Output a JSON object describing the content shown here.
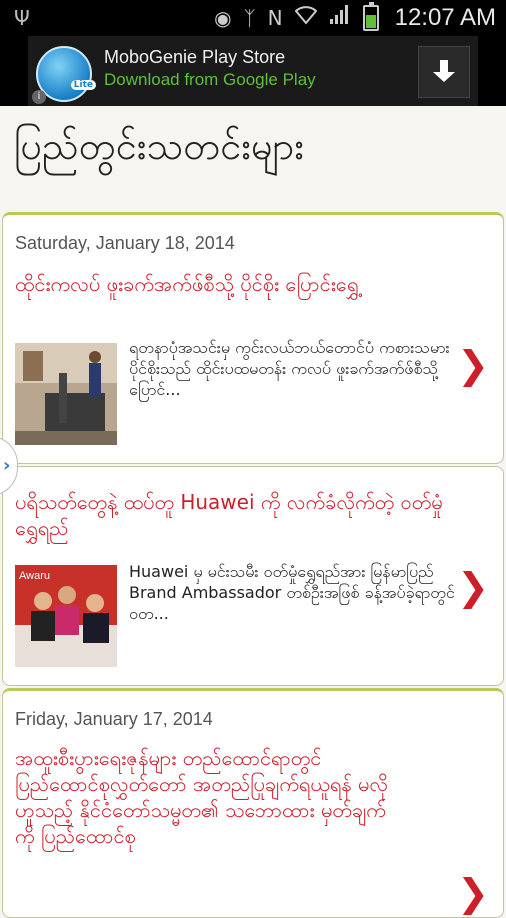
{
  "status_bar": {
    "time": "12:07 AM",
    "icons": [
      "usb-icon",
      "eye-icon",
      "bluetooth-icon",
      "nfc-icon",
      "wifi-icon",
      "signal-icon",
      "battery-icon"
    ]
  },
  "ad": {
    "logo_badge": "Lite",
    "title": "MoboGenie Play Store",
    "subtitle": "Download from Google Play",
    "info": "i",
    "colors": {
      "subtitle": "#5fbf3a",
      "background": "#1a1a1a"
    }
  },
  "header": {
    "title": "ပြည်တွင်းသတင်းများ"
  },
  "feed": {
    "accent_color": "#cc1f2a",
    "sections": [
      {
        "date": "Saturday, January 18, 2014",
        "items": [
          {
            "headline": "ထိုင်းကလပ် ဖူးခက်အက်ဖ်စီသို့ ပိုင်စိုး ပြောင်းရွှေ့",
            "summary": "ရတနာပုံအသင်းမှ ကွင်းလယ်ဘယ်တောင်ပံ ကစားသမား ပိုင်စိုးသည် ထိုင်းပထမတန်း ကလပ် ဖူးခက်အက်ဖ်စီသို့ ပြောင်...",
            "thumb": "treadmill-photo"
          }
        ]
      },
      {
        "date": "",
        "items": [
          {
            "headline": "ပရိသတ်တွေနဲ့ ထပ်တူ Huawei ကို လက်ခံလိုက်တဲ့ ဝတ်မှုံရွှေရည်",
            "summary": "Huawei မှ မင်းသမီး ဝတ်မှုံရွှေရည်အား မြန်မာပြည် Brand Ambassador တစ်ဦးအဖြစ် ခန့်အပ်ခဲ့ရာတွင် ဝတ...",
            "thumb": "press-event-photo",
            "thumb_caption": "Awaru"
          }
        ]
      },
      {
        "date": "Friday, January 17, 2014",
        "items": [
          {
            "headline": "အထူးစီးပွားရေးဇုန်များ တည်ထောင်ရာတွင် ပြည်ထောင်စုလွှတ်တော် အတည်ပြုချက်ရယူရန် မလိုဟူသည့် နိုင်ငံတော်သမ္မတ၏ သဘောထား မှတ်ချက်ကို ပြည်ထောင်စု",
            "summary": "",
            "thumb": ""
          }
        ]
      }
    ]
  }
}
